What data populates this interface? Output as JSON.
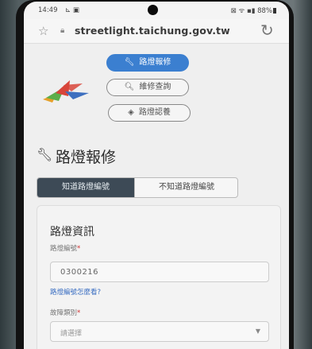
{
  "status_bar": {
    "time": "14:49",
    "indicators": "⊾ ▣",
    "right": "⊠ ᯤ ▪▮ 88%"
  },
  "browser": {
    "url": "streetlight.taichung.gov.tw"
  },
  "nav": {
    "report_label": "路燈報修",
    "progress_label": "維修查詢",
    "adopt_label": "路燈認養"
  },
  "page": {
    "title": "路燈報修",
    "tabs": [
      "知道路燈編號",
      "不知道路燈編號"
    ],
    "active_tab": 0
  },
  "form": {
    "section_title": "路燈資訊",
    "number_label": "路燈編號",
    "number_value": "0300216",
    "help_link": "路燈編號怎麼看?",
    "type_label": "故障類別",
    "type_placeholder": "請選擇",
    "required_mark": "*"
  },
  "colors": {
    "primary": "#3b7fd0",
    "tab_active": "#3d4a56",
    "required": "#d03030",
    "link": "#3a6ec2"
  },
  "icons": {
    "wrench": "wrench-icon",
    "search": "search-icon",
    "handshake": "handshake-icon",
    "star": "star-icon",
    "lock": "lock-icon",
    "reload": "reload-icon"
  }
}
